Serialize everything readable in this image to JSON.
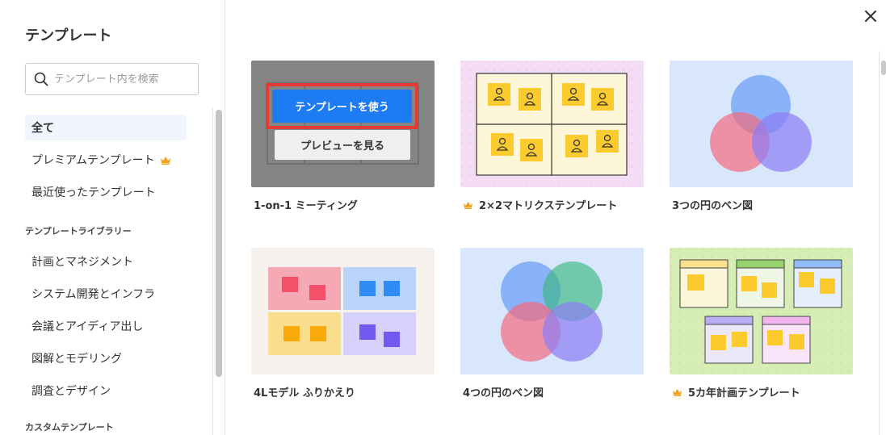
{
  "sidebar": {
    "title": "テンプレート",
    "search": {
      "placeholder": "テンプレート内を検索",
      "value": ""
    },
    "items": [
      {
        "label": "全て",
        "active": true
      },
      {
        "label": "プレミアムテンプレート",
        "premium": true
      },
      {
        "label": "最近使ったテンプレート"
      }
    ],
    "library_title": "テンプレートライブラリー",
    "library_items": [
      {
        "label": "計画とマネジメント"
      },
      {
        "label": "システム開発とインフラ"
      },
      {
        "label": "会議とアイディア出し"
      },
      {
        "label": "図解とモデリング"
      },
      {
        "label": "調査とデザイン"
      }
    ],
    "custom_title": "カスタムテンプレート"
  },
  "overlay": {
    "use_label": "テンプレートを使う",
    "preview_label": "プレビューを見る"
  },
  "cards": [
    {
      "label": "1-on-1 ミーティング",
      "premium": false
    },
    {
      "label": "2×2マトリクステンプレート",
      "premium": true
    },
    {
      "label": "3つの円のベン図",
      "premium": false
    },
    {
      "label": "4Lモデル ふりかえり",
      "premium": false
    },
    {
      "label": "4つの円のベン図",
      "premium": false
    },
    {
      "label": "5カ年計画テンプレート",
      "premium": true
    }
  ],
  "colors": {
    "accent": "#1e7cf2",
    "highlight_frame": "#e53935",
    "crown": "#f0a41c",
    "sticky": "#fccb2e"
  },
  "icons": {
    "close": "close-icon",
    "search": "search-icon",
    "crown": "crown-icon"
  }
}
